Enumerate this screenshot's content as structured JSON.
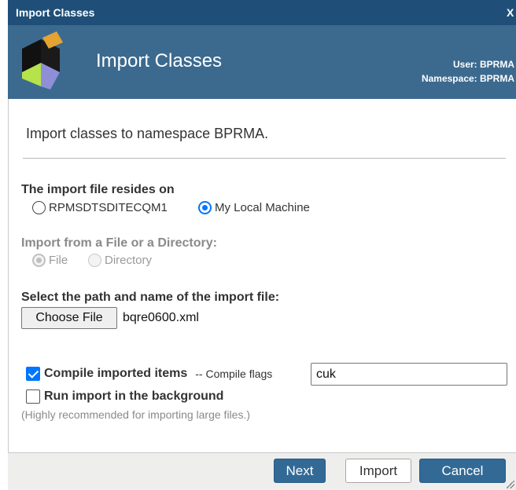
{
  "window": {
    "title": "Import Classes",
    "close_glyph": "X"
  },
  "banner": {
    "title": "Import Classes",
    "user_line": "User: BPRMA",
    "namespace_line": "Namespace: BPRMA",
    "logo_icon": "cube-logo-icon"
  },
  "intro": "Import classes to namespace BPRMA.",
  "file_location": {
    "heading": "The import file resides on",
    "options": [
      {
        "label": "RPMSDTSDITECQM1",
        "selected": false
      },
      {
        "label": "My Local Machine",
        "selected": true
      }
    ]
  },
  "source_type": {
    "heading": "Import from a File or a Directory:",
    "options": [
      {
        "label": "File",
        "selected": true,
        "disabled": true
      },
      {
        "label": "Directory",
        "selected": false,
        "disabled": true
      }
    ]
  },
  "path": {
    "heading": "Select the path and name of the import file:",
    "choose_button": "Choose File",
    "filename": "bqre0600.xml"
  },
  "compile": {
    "label": "Compile imported items",
    "checked": true,
    "flags_label": "-- Compile flags",
    "flags_value": "cuk"
  },
  "background": {
    "label": "Run import in the background",
    "checked": false,
    "hint": "(Highly recommended for importing large files.)"
  },
  "footer": {
    "next": "Next",
    "import": "Import",
    "cancel": "Cancel"
  },
  "colors": {
    "titlebar": "#1f4f78",
    "banner": "#3c6a8f",
    "primary_button": "#336a95",
    "accent": "#0075ff"
  }
}
